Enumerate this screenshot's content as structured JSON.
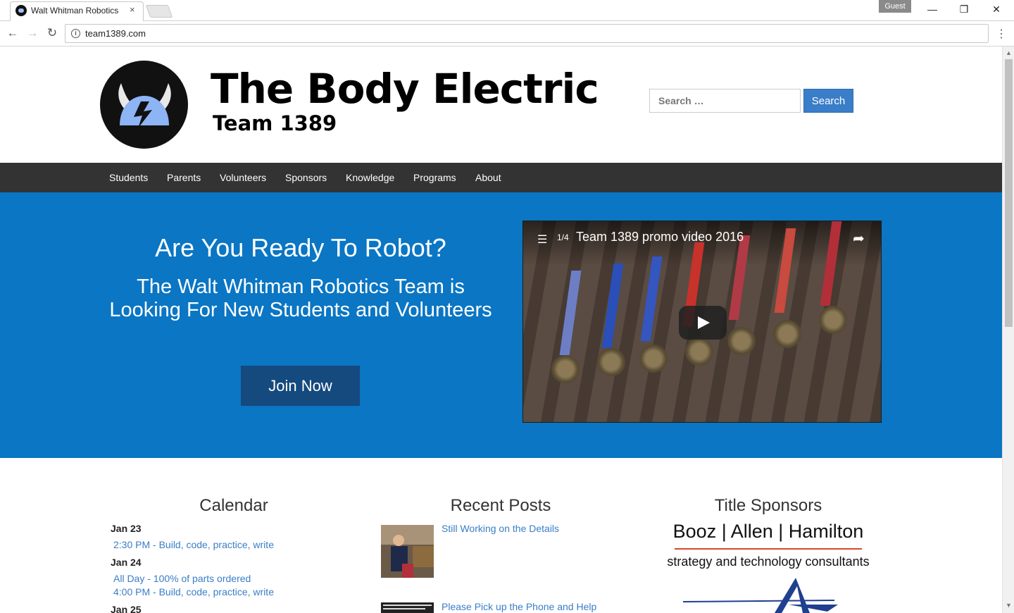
{
  "browser": {
    "tab_title": "Walt Whitman Robotics",
    "tab_close": "×",
    "guest_label": "Guest",
    "url": "team1389.com",
    "window_controls": {
      "minimize": "—",
      "restore": "❐",
      "close": "✕"
    },
    "icons": {
      "back": "←",
      "forward": "→",
      "reload": "↻",
      "info": "i",
      "menu": "⋮"
    }
  },
  "site": {
    "title": "The Body Electric",
    "subtitle": "Team 1389",
    "search": {
      "placeholder": "Search …",
      "button": "Search"
    },
    "nav": [
      "Students",
      "Parents",
      "Volunteers",
      "Sponsors",
      "Knowledge",
      "Programs",
      "About"
    ]
  },
  "hero": {
    "heading": "Are You Ready To Robot?",
    "subheading": "The Walt Whitman Robotics Team is Looking For New Students and Volunteers",
    "cta": "Join Now",
    "video": {
      "playlist_count": "1/4",
      "title": "Team 1389 promo video 2016"
    }
  },
  "calendar": {
    "title": "Calendar",
    "days": [
      {
        "date": "Jan 23",
        "events": [
          "2:30 PM - Build, code, practice, write"
        ]
      },
      {
        "date": "Jan 24",
        "events": [
          "All Day - 100% of parts ordered",
          "4:00 PM - Build, code, practice, write"
        ]
      },
      {
        "date": "Jan 25",
        "events": []
      }
    ]
  },
  "recent_posts": {
    "title": "Recent Posts",
    "posts": [
      "Still Working on the Details",
      "Please Pick up the Phone and Help"
    ]
  },
  "sponsors": {
    "title": "Title Sponsors",
    "booz_name": "Booz | Allen | Hamilton",
    "booz_tagline": "strategy and technology consultants"
  },
  "colors": {
    "nav_bg": "#333333",
    "hero_bg": "#0a76c4",
    "button_blue": "#3a7dc8",
    "join_btn": "#144a7d",
    "link": "#3a7dc8"
  }
}
